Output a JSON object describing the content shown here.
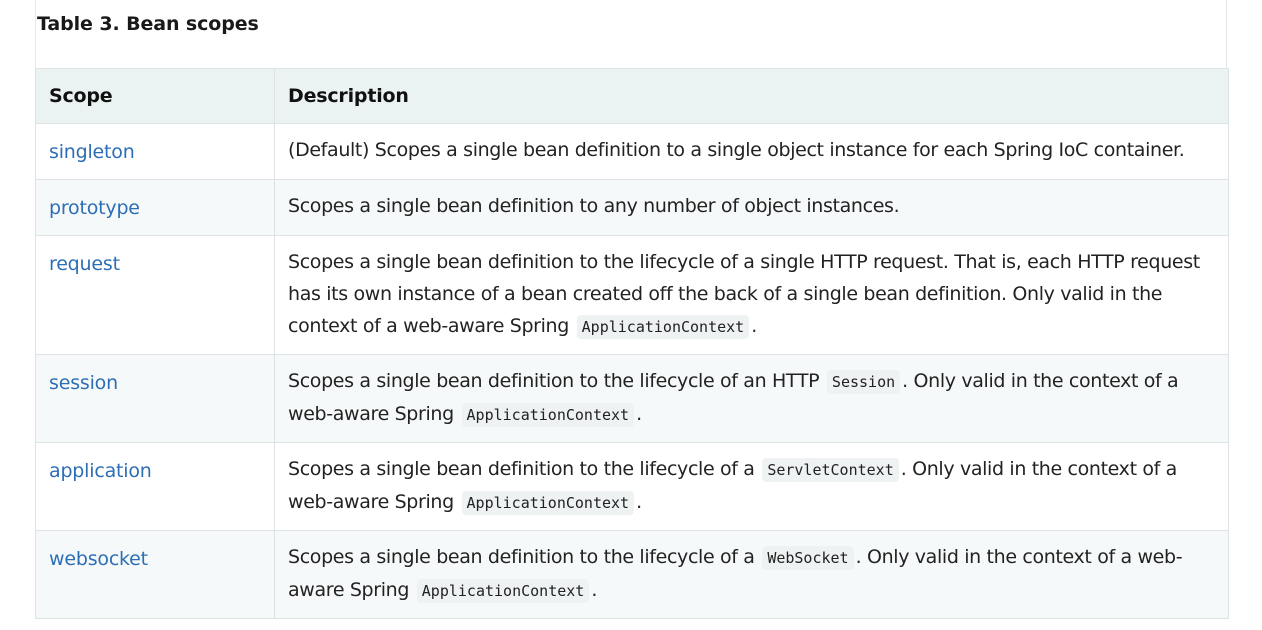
{
  "caption": "Table 3. Bean scopes",
  "table": {
    "headers": [
      "Scope",
      "Description"
    ],
    "rows": [
      {
        "scope": "singleton",
        "desc": {
          "t1": "(Default) Scopes a single bean definition to a single object instance for each Spring IoC container."
        }
      },
      {
        "scope": "prototype",
        "desc": {
          "t1": "Scopes a single bean definition to any number of object instances."
        }
      },
      {
        "scope": "request",
        "desc": {
          "t1": "Scopes a single bean definition to the lifecycle of a single HTTP request. That is, each HTTP request has its own instance of a bean created off the back of a single bean definition. Only valid in the context of a web-aware Spring",
          "c1": "ApplicationContext",
          "t2": "."
        }
      },
      {
        "scope": "session",
        "desc": {
          "t1": "Scopes a single bean definition to the lifecycle of an HTTP",
          "c1": "Session",
          "t2": ". Only valid in the context of a web-aware Spring",
          "c2": "ApplicationContext",
          "t3": "."
        }
      },
      {
        "scope": "application",
        "desc": {
          "t1": "Scopes a single bean definition to the lifecycle of a",
          "c1": "ServletContext",
          "t2": ". Only valid in the context of a web-aware Spring",
          "c2": "ApplicationContext",
          "t3": "."
        }
      },
      {
        "scope": "websocket",
        "desc": {
          "t1": "Scopes a single bean definition to the lifecycle of a",
          "c1": "WebSocket",
          "t2": ". Only valid in the context of a web-aware Spring",
          "c2": "ApplicationContext",
          "t3": "."
        }
      }
    ]
  },
  "colors": {
    "link": "#2c6eb5",
    "header_bg": "#ebf2f2",
    "stripe_bg": "#f6f9f9",
    "code_bg": "#eef2f2",
    "border": "#dde3e5"
  }
}
